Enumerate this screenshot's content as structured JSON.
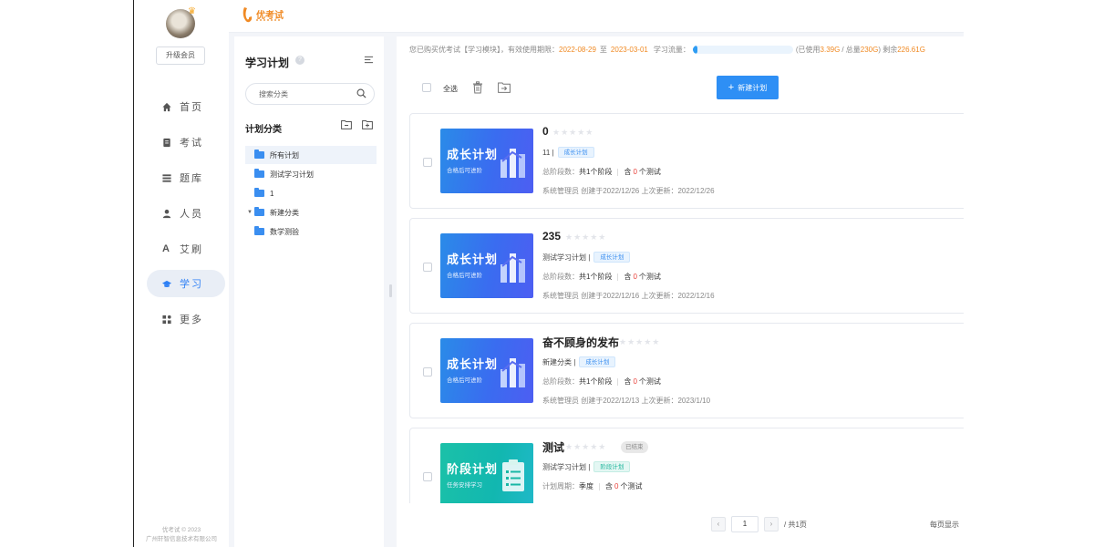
{
  "sidebar": {
    "upgrade_label": "升级会员",
    "items": [
      {
        "label": "首页",
        "icon": "home-icon"
      },
      {
        "label": "考试",
        "icon": "exam-icon"
      },
      {
        "label": "题库",
        "icon": "question-bank-icon"
      },
      {
        "label": "人员",
        "icon": "person-icon"
      },
      {
        "label": "艾刷",
        "icon": "brush-icon"
      },
      {
        "label": "学习",
        "icon": "graduation-cap-icon"
      },
      {
        "label": "更多",
        "icon": "grid-icon"
      }
    ],
    "active_index": 5,
    "footer_line1": "优考试 © 2023",
    "footer_line2": "广州轩智信息技术有限公司"
  },
  "header": {
    "logo_text": "优考试"
  },
  "categories": {
    "title": "学习计划",
    "search_placeholder": "搜索分类",
    "section_title": "计划分类",
    "tree": [
      {
        "label": "所有计划",
        "selected": true,
        "expandable": false
      },
      {
        "label": "测试学习计划",
        "selected": false,
        "expandable": false
      },
      {
        "label": "1",
        "selected": false,
        "expandable": false
      },
      {
        "label": "新建分类",
        "selected": false,
        "expandable": true
      },
      {
        "label": "数学测验",
        "selected": false,
        "expandable": false
      }
    ]
  },
  "notice": {
    "prefix": "您已购买优考试【学习模块】，有效使用期限：",
    "start": "2022-08-29",
    "to": "至",
    "end": "2023-03-01",
    "flow_label": "学习流量：",
    "used_prefix": "(已使用",
    "used": "3.39G",
    "total_prefix": "/ 总量",
    "total": "230G",
    "remain_prefix": ") 剩余",
    "remain": "226.61G",
    "used_fraction": 0.0147
  },
  "toolbar": {
    "select_all": "全选",
    "new_plan": "新建计划"
  },
  "plans": [
    {
      "title": "0",
      "cover_title": "成长计划",
      "cover_sub": "合格后可进阶",
      "cover_style": "blue",
      "category": "11",
      "type_tag": "成长计划",
      "stage_label": "总阶段数：",
      "stages": "共1个阶段",
      "contains_prefix": "含",
      "tests": "0",
      "contains_suffix": "个测试",
      "meta": "系统管理员  创建于2022/12/26  上次更新：2022/12/26",
      "ended": false
    },
    {
      "title": "235",
      "cover_title": "成长计划",
      "cover_sub": "合格后可进阶",
      "cover_style": "blue",
      "category": "测试学习计划",
      "type_tag": "成长计划",
      "stage_label": "总阶段数：",
      "stages": "共1个阶段",
      "contains_prefix": "含",
      "tests": "0",
      "contains_suffix": "个测试",
      "meta": "系统管理员  创建于2022/12/16  上次更新：2022/12/16",
      "ended": false
    },
    {
      "title": "奋不顾身的发布",
      "cover_title": "成长计划",
      "cover_sub": "合格后可进阶",
      "cover_style": "blue",
      "category": "新建分类",
      "type_tag": "成长计划",
      "stage_label": "总阶段数：",
      "stages": "共1个阶段",
      "contains_prefix": "含",
      "tests": "0",
      "contains_suffix": "个测试",
      "meta": "系统管理员  创建于2022/12/13  上次更新：2023/1/10",
      "ended": false
    },
    {
      "title": "测试",
      "cover_title": "阶段计划",
      "cover_sub": "任务安排学习",
      "cover_style": "green",
      "category": "测试学习计划",
      "type_tag": "阶段计划",
      "stage_label": "计划周期：",
      "stages": "季度",
      "contains_prefix": "含",
      "tests": "0",
      "contains_suffix": "个测试",
      "meta": "",
      "ended": true,
      "ended_label": "已结束"
    }
  ],
  "pagination": {
    "page": "1",
    "total": "/ 共1页",
    "per_page_label": "每页显示"
  }
}
